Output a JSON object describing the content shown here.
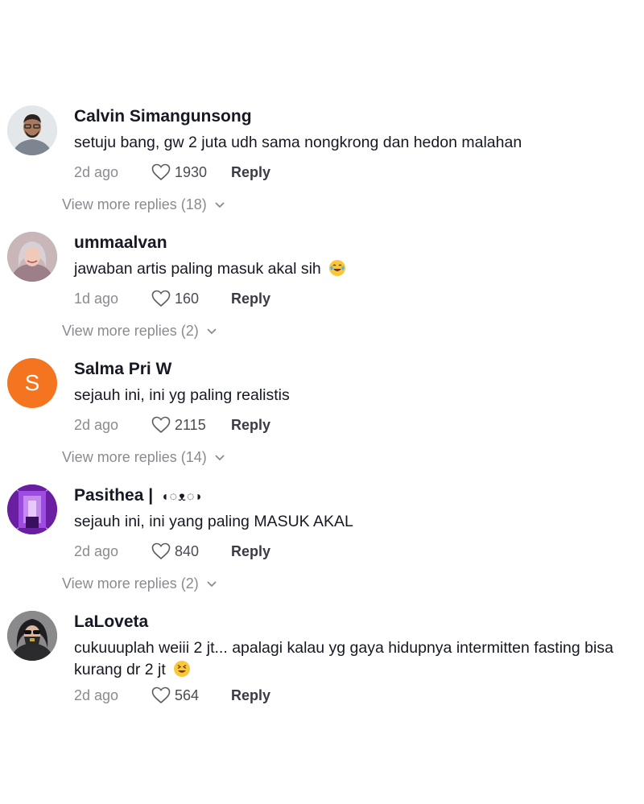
{
  "comments": [
    {
      "username": "Calvin Simangunsong",
      "username_suffix": "",
      "text": "setuju bang, gw 2 juta udh sama nongkrong dan hedon malahan",
      "emoji": "",
      "time": "2d ago",
      "likes": "1930",
      "reply_label": "Reply",
      "more_replies": "View more replies (18)",
      "avatar": {
        "type": "photo",
        "bg": "#d9dde0"
      }
    },
    {
      "username": "ummaalvan",
      "username_suffix": "",
      "text": "jawaban artis paling masuk akal sih",
      "emoji": "😂",
      "time": "1d ago",
      "likes": "160",
      "reply_label": "Reply",
      "more_replies": "View more replies (2)",
      "avatar": {
        "type": "photo",
        "bg": "#b9a4ab"
      }
    },
    {
      "username": "Salma Pri W",
      "username_suffix": "",
      "text": "sejauh ini, ini yg paling realistis",
      "emoji": "",
      "time": "2d ago",
      "likes": "2115",
      "reply_label": "Reply",
      "more_replies": "View more replies (14)",
      "avatar": {
        "type": "initial",
        "initial": "S",
        "bg": "#f4741f"
      }
    },
    {
      "username": "Pasithea |",
      "username_suffix": "◖◌ᴥ◌◗",
      "text": "sejauh ini, ini yang paling MASUK AKAL",
      "emoji": "",
      "time": "2d ago",
      "likes": "840",
      "reply_label": "Reply",
      "more_replies": "View more replies (2)",
      "avatar": {
        "type": "photo",
        "bg": "#8b2fc9"
      }
    },
    {
      "username": "LaLoveta",
      "username_suffix": "",
      "text": "cukuuuplah weiii 2 jt... apalagi kalau yg gaya hidupnya intermitten fasting bisa kurang dr 2 jt",
      "emoji": "😆",
      "time": "2d ago",
      "likes": "564",
      "reply_label": "Reply",
      "more_replies": "",
      "avatar": {
        "type": "photo",
        "bg": "#6e6e70"
      }
    }
  ],
  "colors": {
    "text_primary": "#161823",
    "text_secondary": "#8a8b91",
    "accent_avatar": "#f4741f"
  },
  "icons": [
    "heart-icon",
    "chevron-down-icon"
  ]
}
